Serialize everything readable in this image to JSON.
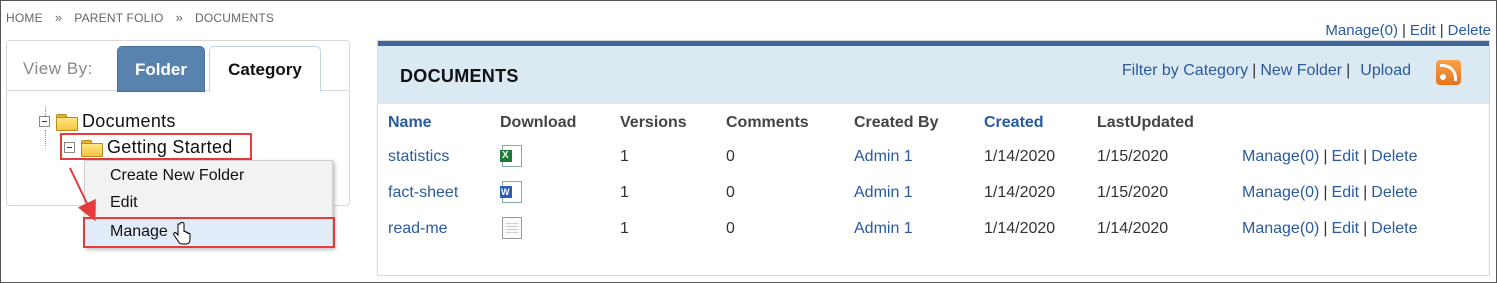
{
  "breadcrumb": {
    "items": [
      "HOME",
      "PARENT FOLIO",
      "DOCUMENTS"
    ],
    "separator": "»"
  },
  "top_actions": {
    "manage": "Manage(0)",
    "edit": "Edit",
    "delete": "Delete",
    "pipe": "|"
  },
  "view_by": {
    "label": "View By:",
    "tabs": [
      "Folder",
      "Category"
    ],
    "selected": "Folder"
  },
  "tree": {
    "root": "Documents",
    "child": "Getting Started"
  },
  "context_menu": {
    "items": [
      "Create New Folder",
      "Edit",
      "Manage"
    ],
    "active": "Manage"
  },
  "documents": {
    "title": "DOCUMENTS",
    "actions": {
      "filter": "Filter by Category",
      "new_folder": "New Folder",
      "upload": "Upload",
      "pipe": "|"
    },
    "columns": [
      "Name",
      "Download",
      "Versions",
      "Comments",
      "Created By",
      "Created",
      "LastUpdated"
    ],
    "rows": [
      {
        "name": "statistics",
        "download_icon": "excel-file-icon",
        "versions": "1",
        "comments": "0",
        "created_by": "Admin 1",
        "created": "1/14/2020",
        "last_updated": "1/15/2020",
        "manage": "Manage(0)",
        "edit": "Edit",
        "delete": "Delete"
      },
      {
        "name": "fact-sheet",
        "download_icon": "word-file-icon",
        "versions": "1",
        "comments": "0",
        "created_by": "Admin 1",
        "created": "1/14/2020",
        "last_updated": "1/15/2020",
        "manage": "Manage(0)",
        "edit": "Edit",
        "delete": "Delete"
      },
      {
        "name": "read-me",
        "download_icon": "text-file-icon",
        "versions": "1",
        "comments": "0",
        "created_by": "Admin 1",
        "created": "1/14/2020",
        "last_updated": "1/14/2020",
        "manage": "Manage(0)",
        "edit": "Edit",
        "delete": "Delete"
      }
    ]
  },
  "colors": {
    "link": "#2a5aa0",
    "tab_active": "#5a82ae",
    "header_band": "#dbe9f2",
    "top_bar": "#3e669a",
    "highlight": "#e53b3b"
  }
}
